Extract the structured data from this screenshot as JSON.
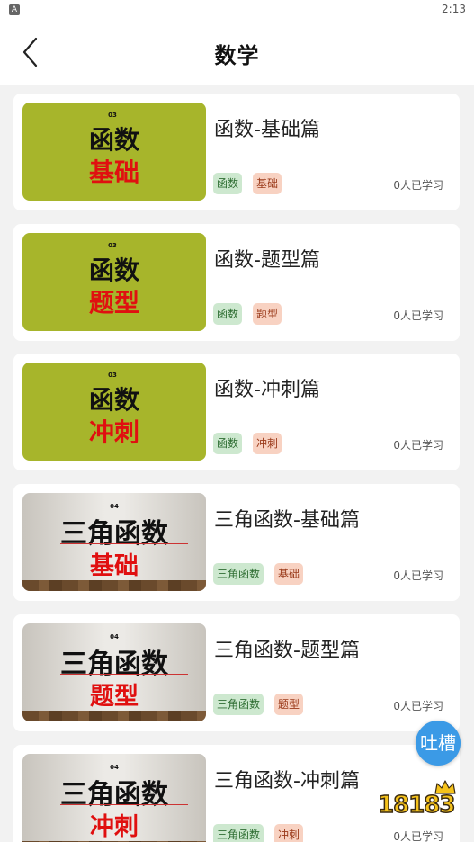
{
  "status_bar": {
    "time": "2:13",
    "app_icon_letter": "A"
  },
  "header": {
    "title": "数学",
    "back_icon": "chevron-left-icon"
  },
  "courses": [
    {
      "cover": {
        "style": "green",
        "number": "03",
        "line1": "函数",
        "line2": "基础"
      },
      "name": "函数-基础篇",
      "tags": [
        "函数",
        "基础"
      ],
      "learners": "0人已学习"
    },
    {
      "cover": {
        "style": "green",
        "number": "03",
        "line1": "函数",
        "line2": "题型"
      },
      "name": "函数-题型篇",
      "tags": [
        "函数",
        "题型"
      ],
      "learners": "0人已学习"
    },
    {
      "cover": {
        "style": "green",
        "number": "03",
        "line1": "函数",
        "line2": "冲刺"
      },
      "name": "函数-冲刺篇",
      "tags": [
        "函数",
        "冲刺"
      ],
      "learners": "0人已学习"
    },
    {
      "cover": {
        "style": "wall",
        "number": "04",
        "line1": "三角函数",
        "line2": "基础"
      },
      "name": "三角函数-基础篇",
      "tags": [
        "三角函数",
        "基础"
      ],
      "learners": "0人已学习"
    },
    {
      "cover": {
        "style": "wall",
        "number": "04",
        "line1": "三角函数",
        "line2": "题型"
      },
      "name": "三角函数-题型篇",
      "tags": [
        "三角函数",
        "题型"
      ],
      "learners": "0人已学习"
    },
    {
      "cover": {
        "style": "wall",
        "number": "04",
        "line1": "三角函数",
        "line2": "冲刺"
      },
      "name": "三角函数-冲刺篇",
      "tags": [
        "三角函数",
        "冲刺"
      ],
      "learners": "0人已学习"
    }
  ],
  "feedback_button": {
    "label": "吐槽"
  },
  "watermark": {
    "text": "18183"
  },
  "colors": {
    "cover_green": "#a7b52b",
    "cover_red_text": "#e01010",
    "tag_green_bg": "#cde8cf",
    "tag_red_bg": "#f8d2c2",
    "feedback_blue": "#3b9ae6"
  }
}
